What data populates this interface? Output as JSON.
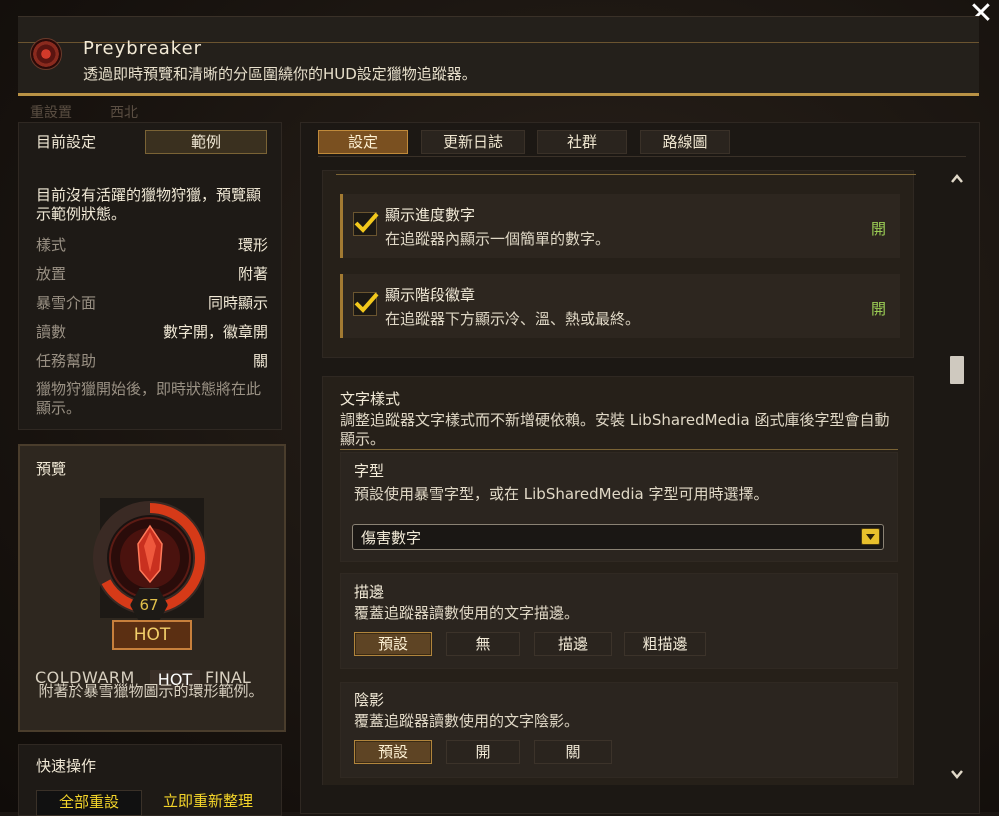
{
  "header": {
    "title": "Preybreaker",
    "subtitle": "透過即時預覽和清晰的分區圍繞你的HUD設定獵物追蹤器。"
  },
  "ghost_text": {
    "left": "重設置",
    "mid": "西北"
  },
  "current": {
    "title": "目前設定",
    "sample_button": "範例",
    "note": "目前沒有活躍的獵物狩獵，預覽顯示範例狀態。",
    "rows": [
      {
        "key": "樣式",
        "value": "環形"
      },
      {
        "key": "放置",
        "value": "附著"
      },
      {
        "key": "暴雪介面",
        "value": "同時顯示"
      },
      {
        "key": "讀數",
        "value": "數字開，徽章開"
      },
      {
        "key": "任務幫助",
        "value": "關"
      }
    ],
    "footer": "獵物狩獵開始後，即時狀態將在此顯示。"
  },
  "preview": {
    "title": "預覽",
    "progress": 67,
    "number": "67",
    "badge": "HOT",
    "stages": [
      "COLD",
      "WARM",
      "HOT",
      "FINAL"
    ],
    "active_stage": "HOT",
    "caption": "附著於暴雪獵物圖示的環形範例。"
  },
  "quick": {
    "title": "快速操作",
    "reset_all": "全部重設",
    "reorganize": "立即重新整理"
  },
  "tabs": [
    {
      "label": "設定",
      "active": true
    },
    {
      "label": "更新日誌",
      "active": false
    },
    {
      "label": "社群",
      "active": false
    },
    {
      "label": "路線圖",
      "active": false
    }
  ],
  "settings": {
    "show_progress": {
      "title": "顯示進度數字",
      "desc": "在追蹤器內顯示一個簡單的數字。",
      "state": "開",
      "checked": true
    },
    "show_badge": {
      "title": "顯示階段徽章",
      "desc": "在追蹤器下方顯示冷、溫、熱或最終。",
      "state": "開",
      "checked": true
    },
    "text_style": {
      "title": "文字樣式",
      "desc": "調整追蹤器文字樣式而不新增硬依賴。安裝 LibSharedMedia 函式庫後字型會自動顯示。"
    },
    "font": {
      "title": "字型",
      "desc": "預設使用暴雪字型，或在 LibSharedMedia 字型可用時選擇。",
      "selected": "傷害數字"
    },
    "outline": {
      "title": "描邊",
      "desc": "覆蓋追蹤器讀數使用的文字描邊。",
      "options": [
        "預設",
        "無",
        "描邊",
        "粗描邊"
      ],
      "selected": "預設"
    },
    "shadow": {
      "title": "陰影",
      "desc": "覆蓋追蹤器讀數使用的文字陰影。",
      "options": [
        "預設",
        "開",
        "關"
      ],
      "selected": "預設"
    }
  },
  "colors": {
    "accent_gold": "#b99245",
    "on_green": "#9ccf55",
    "tab_active": "#7a5020",
    "hot_badge": "#c8803c"
  }
}
